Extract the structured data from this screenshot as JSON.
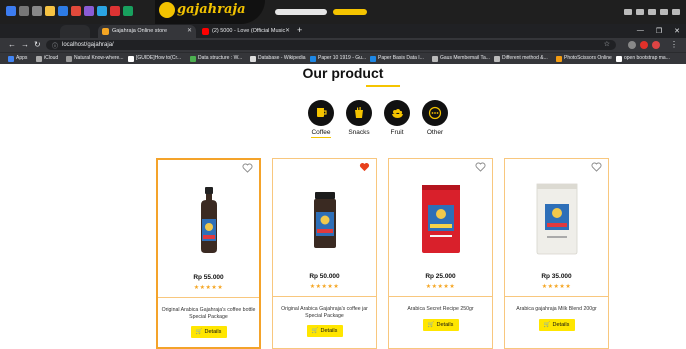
{
  "browser": {
    "taskbar_brand": "gajahraja",
    "tabs": [
      {
        "title": "Gajahraja Online store",
        "active": true
      },
      {
        "title": "(2) 5000 - Love (Official Music",
        "active": false
      }
    ],
    "url": "localhost/gajahraja/",
    "bookmarks": [
      "Apps",
      "iCloud",
      "Natural Know-where...",
      "[GUIDE]How to(Cr...",
      "Data structure : W...",
      "Database - Wikipedia",
      "Paper 10 1919 - Gu...",
      "Paper Basis Data I...",
      "Gaus Membemail Ta...",
      "Different method &...",
      "PhotoScissors Online",
      "open bootstrap ma..."
    ]
  },
  "page": {
    "section_title": "Our product"
  },
  "categories": [
    {
      "label": "Coffee",
      "icon": "coffee-cup-icon",
      "active": true
    },
    {
      "label": "Snacks",
      "icon": "snack-cup-icon",
      "active": false
    },
    {
      "label": "Fruit",
      "icon": "fruit-bowl-icon",
      "active": false
    },
    {
      "label": "Other",
      "icon": "more-dots-icon",
      "active": false
    }
  ],
  "products": [
    {
      "price": "Rp 55.000",
      "stars": "★★★★★",
      "name": "Original Arabica Gajahraja's coffee bottle Special Package",
      "details_label": "Details",
      "favorited": false,
      "image": "bottle"
    },
    {
      "price": "Rp 50.000",
      "stars": "★★★★★",
      "name": "Original Arabica Gajahraja's coffee jar Special Package",
      "details_label": "Details",
      "favorited": true,
      "image": "jar"
    },
    {
      "price": "Rp 25.000",
      "stars": "★★★★★",
      "name": "Arabica Secret Recipe 250gr",
      "details_label": "Details",
      "favorited": false,
      "image": "red-pouch"
    },
    {
      "price": "Rp 35.000",
      "stars": "★★★★★",
      "name": "Arabica gajahraja Milk Blend 200gr",
      "details_label": "Details",
      "favorited": false,
      "image": "white-pouch"
    }
  ],
  "colors": {
    "accent": "#f5c400",
    "card_border": "#f8c77e",
    "card_border_highlight": "#f4a32a",
    "details_button": "#ffe600",
    "heart_filled": "#e8401c",
    "stars": "#f5a623"
  }
}
